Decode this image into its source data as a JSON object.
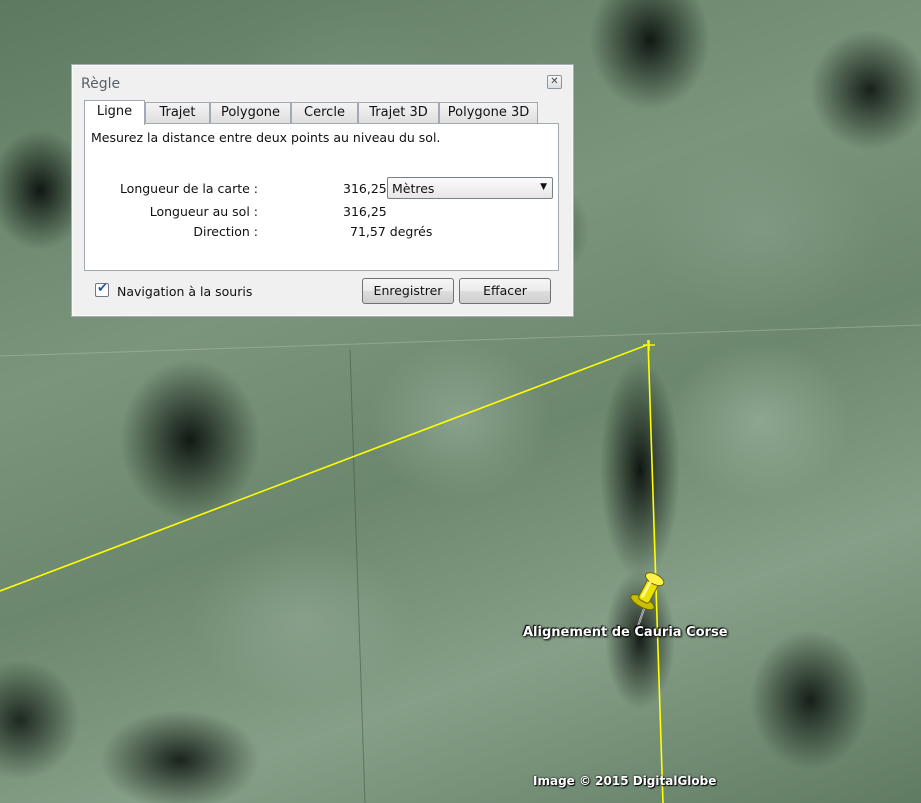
{
  "map": {
    "placemark_label": "Alignement de Cauria Corse",
    "imagery_credit": "Image © 2015 DigitalGlobe",
    "ruler_line_color": "#ffff00",
    "pin_color": "#f2e600",
    "pin_icon": "pushpin-icon"
  },
  "dialog": {
    "title": "Règle",
    "close_label": "✕",
    "tabs": [
      {
        "label": "Ligne",
        "active": true
      },
      {
        "label": "Trajet",
        "active": false
      },
      {
        "label": "Polygone",
        "active": false
      },
      {
        "label": "Cercle",
        "active": false
      },
      {
        "label": "Trajet 3D",
        "active": false
      },
      {
        "label": "Polygone 3D",
        "active": false
      }
    ],
    "description": "Mesurez la distance entre deux points au niveau du sol.",
    "map_length": {
      "label": "Longueur de la carte :",
      "value": "316,25"
    },
    "unit_select": {
      "value": "Mètres"
    },
    "ground_length": {
      "label": "Longueur au sol :",
      "value": "316,25"
    },
    "direction": {
      "label": "Direction :",
      "value": "71,57 degrés"
    },
    "mouse_navigation": {
      "label": "Navigation à la souris",
      "checked": true
    },
    "save_label": "Enregistrer",
    "clear_label": "Effacer"
  }
}
